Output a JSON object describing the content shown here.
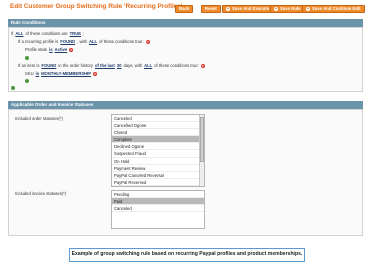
{
  "page": {
    "title": "Edit Customer Group Switching Rule 'Recurring Profiles'"
  },
  "toolbar": {
    "back_label": "Back",
    "reset_label": "Reset",
    "save_and_execute_label": "Save And Execute",
    "save_rule_label": "Save Rule",
    "save_and_continue_label": "Save And Continue Edit"
  },
  "rule_conditions": {
    "header": "Rule Conditions",
    "line1": {
      "prefix": "If",
      "aggregator": "ALL",
      "middle": "of these conditions are",
      "value": "TRUE",
      "suffix": ":"
    },
    "line2": {
      "prefix": "If a recurring profile is",
      "found": "FOUND",
      "middle": ", with",
      "aggregator": "ALL",
      "suffix": "of these conditions true:"
    },
    "line3": {
      "attribute": "Profile state",
      "operator": "is",
      "value": "Active"
    },
    "line4": {
      "prefix": "If an item is",
      "found": "FOUND",
      "middle1": "in the order history",
      "period": "of the last",
      "days": "30",
      "middle2": "days, with",
      "aggregator": "ALL",
      "suffix": "of these conditions true:"
    },
    "line5": {
      "attribute": "SKU",
      "operator": "is",
      "value": "MONTHLY-MEMBERSHIP"
    }
  },
  "statuses": {
    "header": "Applicable Order and Invoice Statuses",
    "order_label": "Included order statuses(*)",
    "order_options": [
      "Canceled",
      "Cancelled Ogone",
      "Closed",
      "Complete",
      "Declined Ogone",
      "Suspected Fraud",
      "On Hold",
      "Payment Review",
      "PayPal Canceled Reversal",
      "PayPal Reversed"
    ],
    "order_selected": "Complete",
    "invoice_label": "Included invoice statuses(*)",
    "invoice_options": [
      "Pending",
      "Paid",
      "Canceled"
    ],
    "invoice_selected": "Paid"
  },
  "caption": "Example of group switching rule based on recurring Paypal profiles and product memberships.",
  "colors": {
    "accent": "#e26b1a",
    "section_header": "#6b94ab",
    "caption_border": "#5b9bd5"
  }
}
